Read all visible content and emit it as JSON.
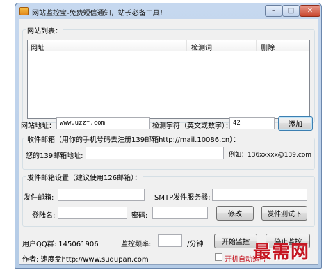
{
  "window": {
    "title": "网站监控宝-免费短信通知，站长必备工具！",
    "buttons": {
      "minimize": "–",
      "maximize": "□",
      "close": "✕"
    }
  },
  "site_list": {
    "group_label": "网站列表：",
    "columns": [
      "网址",
      "检测词",
      "删除"
    ]
  },
  "add_site": {
    "url_label": "网站地址：",
    "url_value": "www.uzzf.com",
    "keyword_label": "检测字符（英文或数字）：",
    "keyword_value": "42",
    "add_button": "添加"
  },
  "receive_mail": {
    "group_label": "收件邮箱（用你的手机号码去注册139邮箱http://mail.10086.cn）：",
    "address_label": "您的139邮箱地址:",
    "address_value": "",
    "example": "例如：136xxxxx@139.com"
  },
  "send_mail": {
    "group_label": "发件邮箱设置（建议使用126邮箱）：",
    "sender_label": "发件邮箱:",
    "sender_value": "",
    "smtp_label": "SMTP发件服务器:",
    "smtp_value": "",
    "login_label": "登陆名:",
    "login_value": "",
    "password_label": "密码:",
    "password_value": "",
    "modify_button": "修改",
    "test_button": "发件测试下"
  },
  "footer": {
    "qq_group": "用户QQ群: 145061906",
    "interval_label": "监控频率:",
    "interval_value": "",
    "interval_unit": "/分钟",
    "start_button": "开始监控",
    "stop_button": "停止监控",
    "author": "作者: 速度盘http://www.sudupan.com",
    "autostart_label": "开机自动运行"
  },
  "watermark": "最需网"
}
